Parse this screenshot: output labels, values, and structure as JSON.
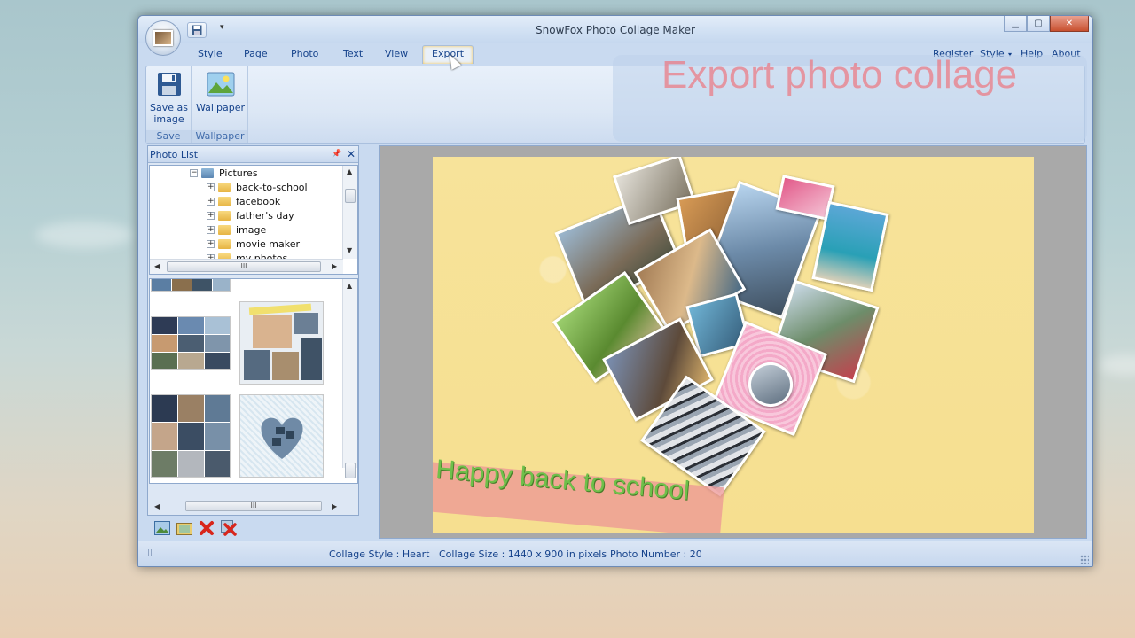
{
  "window": {
    "title": "SnowFox Photo Collage Maker"
  },
  "ribbon": {
    "tabs": [
      "Style",
      "Page",
      "Photo",
      "Text",
      "View",
      "Export"
    ],
    "active_tab": "Export",
    "right_menu": [
      "Register",
      "Style",
      "Help",
      "About"
    ],
    "groups": [
      {
        "label": "Save",
        "buttons": [
          {
            "label": "Save as image",
            "icon": "floppy-disk-icon"
          }
        ]
      },
      {
        "label": "Wallpaper",
        "buttons": [
          {
            "label": "Wallpaper",
            "icon": "landscape-icon"
          }
        ]
      }
    ],
    "save_btn_line1": "Save as",
    "save_btn_line2": "image",
    "watermark": "Export photo collage"
  },
  "photo_list": {
    "title": "Photo List",
    "tree": [
      {
        "label": "Pictures",
        "icon": "pictures-folder-icon"
      },
      {
        "label": "back-to-school",
        "icon": "folder-icon"
      },
      {
        "label": "facebook",
        "icon": "folder-icon"
      },
      {
        "label": "father's day",
        "icon": "folder-icon"
      },
      {
        "label": "image",
        "icon": "folder-icon"
      },
      {
        "label": "movie maker",
        "icon": "folder-icon"
      },
      {
        "label": "my photos",
        "icon": "folder-icon"
      }
    ],
    "scroll_grip": "III",
    "tools": [
      "add-photo-icon",
      "add-folder-icon",
      "remove-icon",
      "remove-all-icon"
    ]
  },
  "canvas": {
    "banner_text": "Happy back to school",
    "colors": {
      "background": "#f7e39a",
      "banner": "#ec9696",
      "banner_text": "#6fc04a"
    }
  },
  "status": {
    "collage_style": "Collage Style : Heart",
    "collage_size": "Collage Size : 1440 x 900  in pixels",
    "photo_number": "Photo Number : 20"
  }
}
